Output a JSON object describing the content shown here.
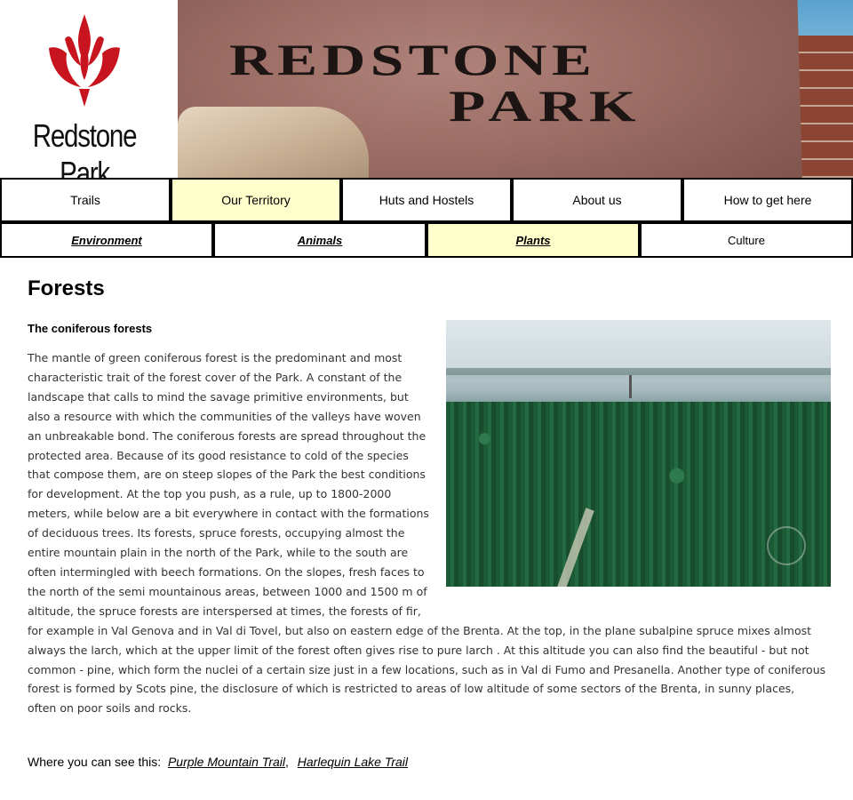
{
  "header": {
    "logo_text": "Redstone Park",
    "banner_line1": "REDSTONE",
    "banner_line2": "PARK"
  },
  "main_nav": {
    "items": [
      {
        "label": "Trails"
      },
      {
        "label": "Our Territory",
        "active": true
      },
      {
        "label": "Huts and Hostels"
      },
      {
        "label": "About us"
      },
      {
        "label": "How to get here"
      }
    ]
  },
  "sub_nav": {
    "items": [
      {
        "label": "Environment"
      },
      {
        "label": "Animals"
      },
      {
        "label": "Plants",
        "active": true
      },
      {
        "label": "Culture"
      }
    ]
  },
  "content": {
    "title": "Forests",
    "subtitle": "The coniferous forests",
    "body": "The mantle of green coniferous forest is the predominant and most characteristic trait of the forest cover of the Park. A constant of the landscape that calls to mind the savage primitive environments, but also a resource with which the communities of the valleys have woven an unbreakable bond. The coniferous forests are spread throughout the protected area. Because of its good resistance to cold of the species that compose them, are on steep slopes of the Park the best conditions for development. At the top you push, as a rule, up to 1800-2000 meters, while below are a bit everywhere in contact with the formations of deciduous trees. Its forests, spruce forests, occupying almost the entire mountain plain in the north of the Park, while to the south are often intermingled with beech formations. On the slopes, fresh faces to the north of the semi mountainous areas, between 1000 and 1500 m of altitude, the spruce forests are interspersed at times, the forests of fir, for example in Val Genova and in Val di Tovel, but also on eastern edge of the Brenta. At the top, in the plane subalpine spruce mixes almost always the larch, which at the upper limit of the forest often gives rise to pure larch . At this altitude you can also find the beautiful - but not common - pine, which form the nuclei of a certain size just in a few locations, such as in Val di Fumo and Presanella. Another type of coniferous forest is formed by Scots pine, the disclosure of which is restricted to areas of low altitude of some sectors of the Brenta, in sunny places, often on poor soils and rocks.",
    "see_label": "Where you can see this:",
    "trails": [
      "Purple Mountain Trail",
      "Harlequin Lake Trail"
    ],
    "trail_separator": ","
  },
  "colors": {
    "active_tab": "#ffffcc",
    "logo_red": "#c8141e"
  }
}
